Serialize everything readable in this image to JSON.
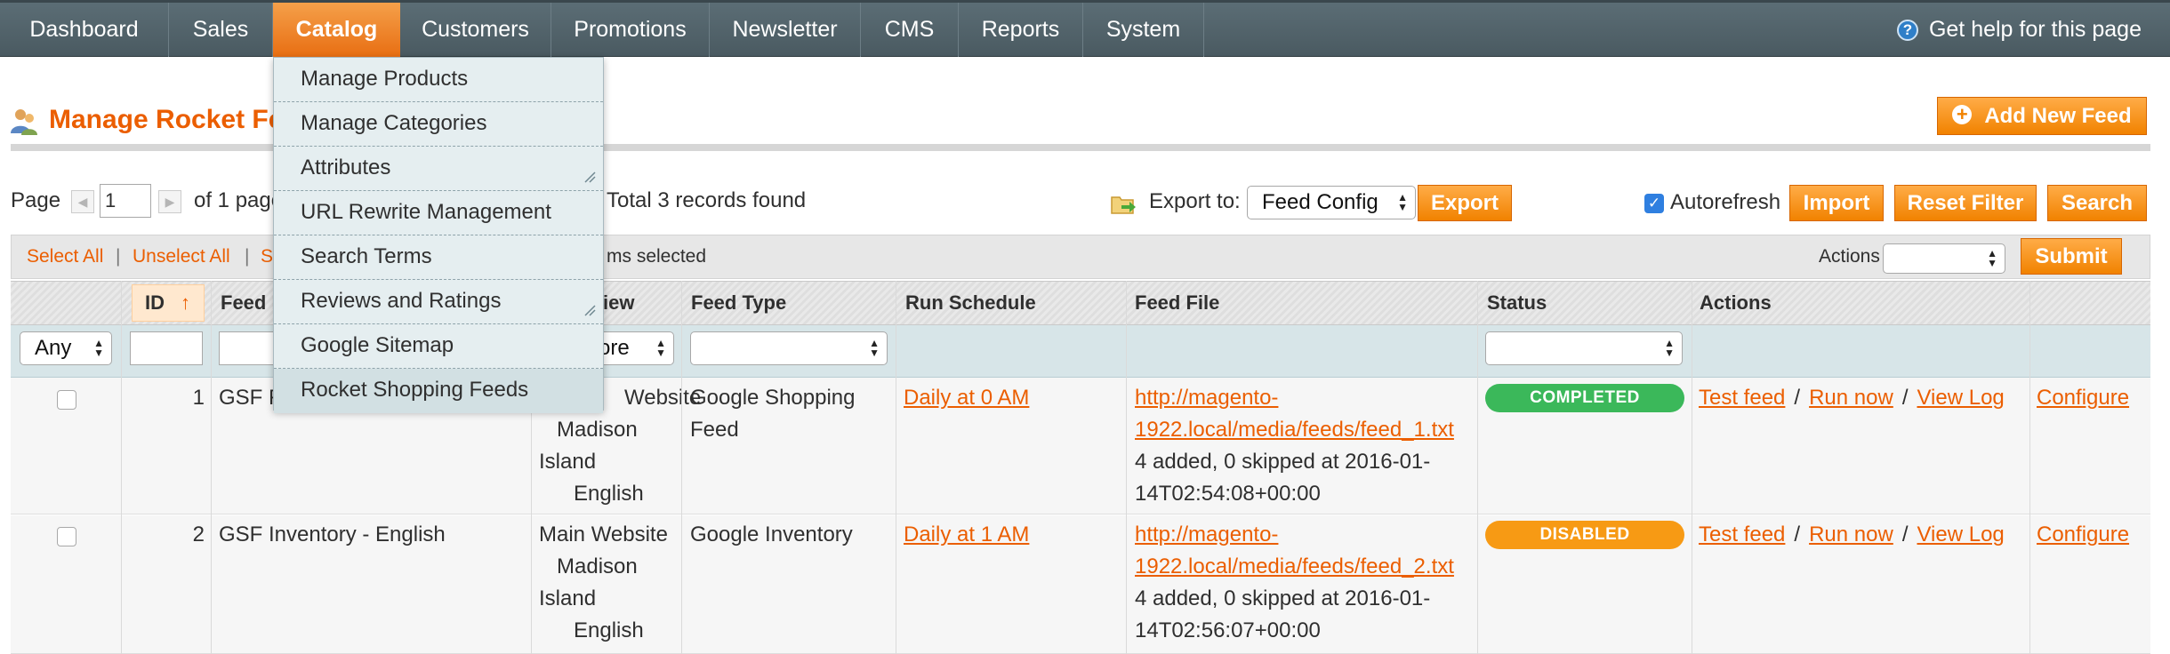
{
  "nav": {
    "items": [
      {
        "label": "Dashboard"
      },
      {
        "label": "Sales"
      },
      {
        "label": "Catalog"
      },
      {
        "label": "Customers"
      },
      {
        "label": "Promotions"
      },
      {
        "label": "Newsletter"
      },
      {
        "label": "CMS"
      },
      {
        "label": "Reports"
      },
      {
        "label": "System"
      }
    ],
    "active": "Catalog",
    "help_label": "Get help for this page"
  },
  "catalog_menu": {
    "items": [
      "Manage Products",
      "Manage Categories",
      "Attributes",
      "URL Rewrite Management",
      "Search Terms",
      "Reviews and Ratings",
      "Google Sitemap",
      "Rocket Shopping Feeds"
    ]
  },
  "page": {
    "title": "Manage Rocket Feeds",
    "add_button": "Add New Feed"
  },
  "pager": {
    "page_label": "Page",
    "page_value": "1",
    "of_pages": "of 1 pages",
    "records_found": "Total 3 records found",
    "export_label": "Export to:",
    "export_format": "Feed Config",
    "export_button": "Export",
    "autorefresh_label": "Autorefresh",
    "import_button": "Import",
    "reset_filter_button": "Reset Filter",
    "search_button": "Search"
  },
  "massaction": {
    "select_all": "Select All",
    "unselect_all": "Unselect All",
    "select_visible_partial": "S",
    "items_selected_partial": "ms selected",
    "actions_label": "Actions",
    "submit_button": "Submit"
  },
  "columns": {
    "id": "ID",
    "feed_name_partial": "Feed N",
    "store_view_partial": "iew",
    "feed_type": "Feed Type",
    "run_schedule": "Run Schedule",
    "feed_file": "Feed File",
    "status": "Status",
    "actions": "Actions"
  },
  "filters": {
    "any": "Any",
    "store_partial": "ore"
  },
  "rows": [
    {
      "id": "1",
      "name_partial": "GSF F",
      "store_line1_partial": "Website",
      "store_line2": "Madison",
      "store_line3": "Island",
      "store_line4": "English",
      "type_line1": "Google Shopping",
      "type_line2": "Feed",
      "schedule": "Daily at 0 AM",
      "file_link_line1": "http://magento-",
      "file_link_line2": "1922.local/media/feeds/feed_1.txt",
      "file_info_line1": "4 added, 0 skipped at 2016-01-",
      "file_info_line2": "14T02:54:08+00:00",
      "status": "COMPLETED",
      "status_color": "#3bb85a",
      "action_test": "Test feed",
      "action_run": "Run now",
      "action_log": "View Log",
      "action_configure": "Configure"
    },
    {
      "id": "2",
      "name": "GSF Inventory - English",
      "store_line1": "Main Website",
      "store_line2": "Madison",
      "store_line3": "Island",
      "store_line4": "English",
      "type_line1": "Google Inventory",
      "schedule": "Daily at 1 AM",
      "file_link_line1": "http://magento-",
      "file_link_line2": "1922.local/media/feeds/feed_2.txt",
      "file_info_line1": "4 added, 0 skipped at 2016-01-",
      "file_info_line2": "14T02:56:07+00:00",
      "status": "DISABLED",
      "status_color": "#f79a14",
      "action_test": "Test feed",
      "action_run": "Run now",
      "action_log": "View Log",
      "action_configure": "Configure"
    }
  ],
  "colors": {
    "accent_orange": "#eb5e00",
    "nav_background": "#4f6068",
    "status_completed": "#3bb85a",
    "status_disabled": "#f79a14"
  },
  "icons": [
    "help-icon",
    "users-icon",
    "plus-icon",
    "export-icon",
    "sort-arrow-icon",
    "resize-corner-icon"
  ]
}
